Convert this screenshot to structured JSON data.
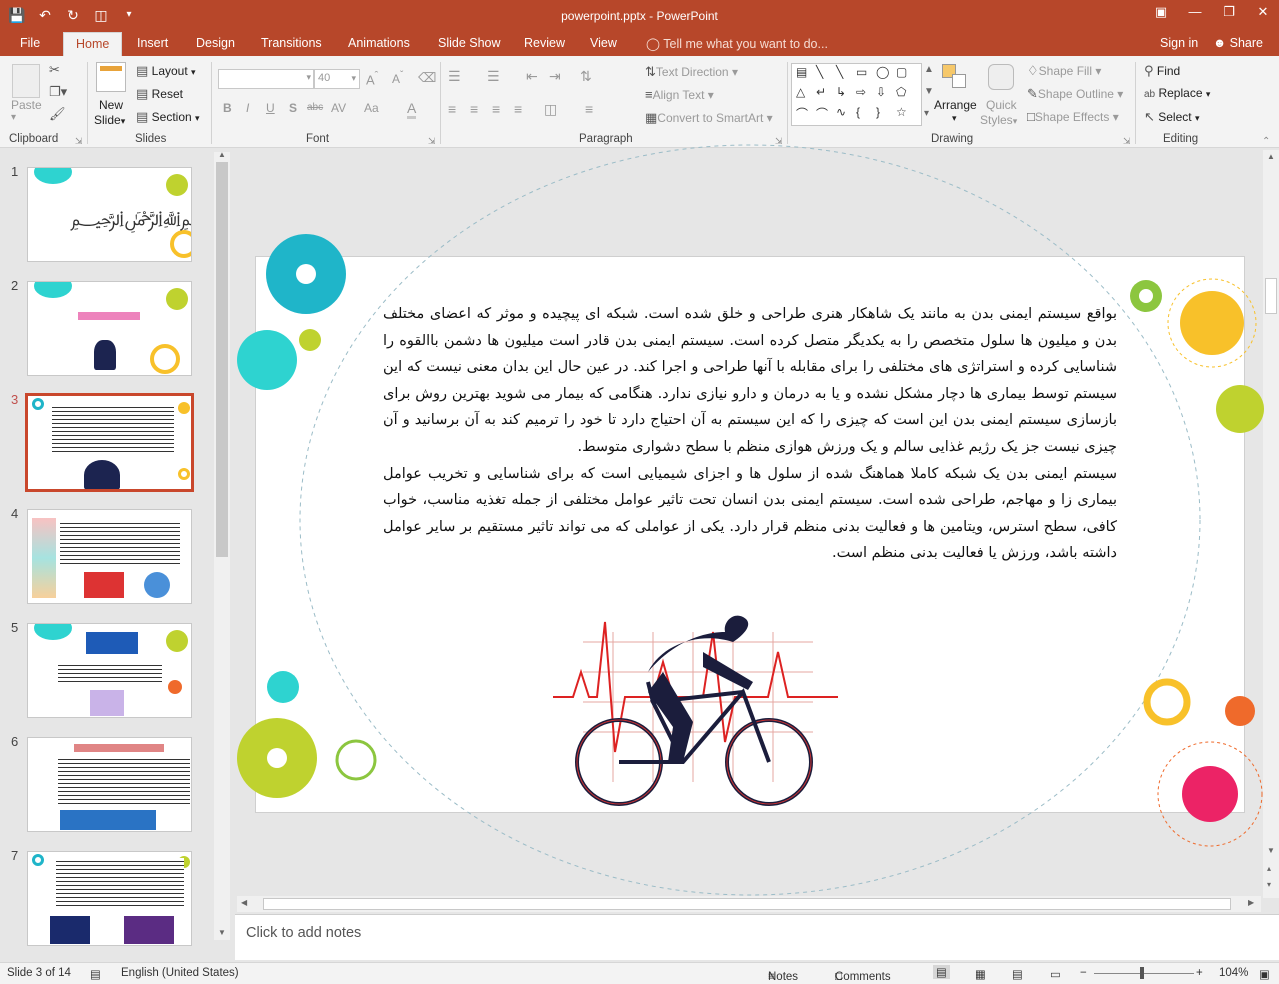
{
  "app": {
    "title": "powerpoint.pptx - PowerPoint",
    "accent": "#b7472a"
  },
  "tabs": [
    "File",
    "Home",
    "Insert",
    "Design",
    "Transitions",
    "Animations",
    "Slide Show",
    "Review",
    "View"
  ],
  "active_tab": "Home",
  "tell_me": "Tell me what you want to do...",
  "account": {
    "signin": "Sign in",
    "share": "Share"
  },
  "ribbon": {
    "clipboard": {
      "label": "Clipboard",
      "paste": "Paste"
    },
    "slides": {
      "label": "Slides",
      "new_slide": "New",
      "new_slide2": "Slide",
      "layout": "Layout",
      "reset": "Reset",
      "section": "Section"
    },
    "font": {
      "label": "Font",
      "size": "40",
      "bold": "B",
      "italic": "I",
      "underline": "U",
      "shadow": "S",
      "strike": "abc",
      "spacing": "AV",
      "case": "Aa",
      "color": "A"
    },
    "paragraph": {
      "label": "Paragraph",
      "text_direction": "Text Direction",
      "align_text": "Align Text",
      "smartart": "Convert to SmartArt"
    },
    "drawing": {
      "label": "Drawing",
      "arrange": "Arrange",
      "quick_styles": "Quick",
      "quick_styles2": "Styles",
      "shape_fill": "Shape Fill",
      "shape_outline": "Shape Outline",
      "shape_effects": "Shape Effects"
    },
    "editing": {
      "label": "Editing",
      "find": "Find",
      "replace": "Replace",
      "select": "Select"
    }
  },
  "thumbnails": [
    "1",
    "2",
    "3",
    "4",
    "5",
    "6",
    "7"
  ],
  "active_slide": "3",
  "slide_text": {
    "p1": "بواقع سیستم ایمنی بدن به مانند یک شاهکار هنری طراحی و خلق شده است. شبکه ای پیچیده و موثر که اعضای مختلف بدن و میلیون ها سلول متخصص را به یکدیگر متصل کرده است. سیستم ایمنی بدن قادر است میلیون ها دشمن باالقوه را شناسایی کرده و استراتژی های مختلفی را برای مقابله با آنها طراحی و اجرا کند. در عین حال این بدان معنی نیست که این سیستم توسط بیماری ها دچار مشکل نشده و یا به درمان و دارو نیازی ندارد. هنگامی که بیمار می شوید بهترین روش برای بازسازی سیستم ایمنی بدن این است که چیزی را که این سیستم به آن احتیاج دارد تا خود را ترمیم کند به آن برسانید و آن چیزی نیست جز یک رژیم غذایی سالم و یک ورزش هوازی منظم با سطح دشواری متوسط.",
    "p2": "سیستم ایمنی بدن یک شبکه کاملا هماهنگ شده از سلول ها و اجزای شیمیایی است که برای شناسایی و تخریب عوامل بیماری زا و مهاجم، طراحی شده است. سیستم ایمنی بدن انسان تحت تاثیر عوامل مختلفی از جمله تغذیه مناسب، خواب کافی، سطح استرس، ویتامین ها و فعالیت بدنی منظم قرار دارد. یکی از عواملی که می تواند تاثیر مستقیم بر سایر عوامل داشته باشد، ورزش یا فعالیت بدنی منظم است."
  },
  "notes_placeholder": "Click to add notes",
  "status": {
    "slide": "Slide 3 of 14",
    "language": "English (United States)",
    "notes": "Notes",
    "comments": "Comments",
    "zoom": "104%"
  },
  "colors": {
    "teal": "#1fb5c9",
    "cyan": "#2ed3d0",
    "lime": "#bfd22f",
    "yellow": "#f8c12a",
    "orange": "#ef6a2b",
    "pink": "#ec2366",
    "green": "#8cc63f"
  }
}
